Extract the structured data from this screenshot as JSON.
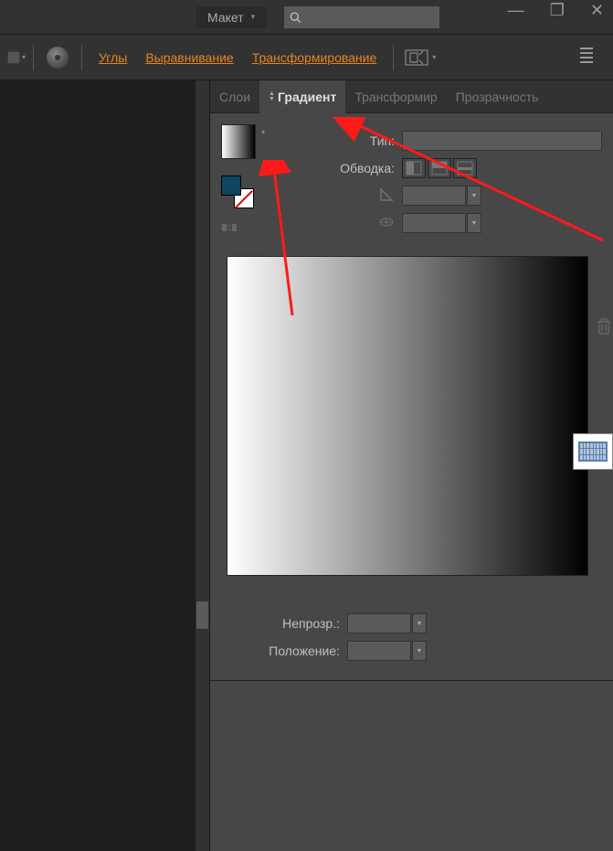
{
  "top": {
    "layout_label": "Макет",
    "search_placeholder": ""
  },
  "toolbar": {
    "link1": "Углы",
    "link2": "Выравнивание",
    "link3": "Трансформирование"
  },
  "tabs": {
    "t1": "Слои",
    "t2": "Градиент",
    "t3": "Трансформир",
    "t4": "Прозрачность"
  },
  "panel": {
    "type_label": "Тип:",
    "stroke_label": "Обводка:",
    "opacity_label": "Непрозр.:",
    "position_label": "Положение:"
  },
  "colors": {
    "fill": "#104560",
    "accent": "#e8841a",
    "arrow": "#ff1a1a"
  }
}
